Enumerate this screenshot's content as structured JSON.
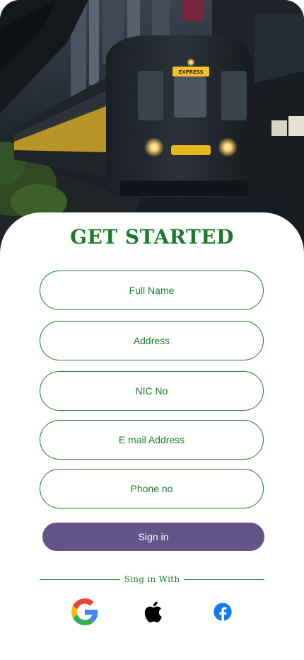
{
  "hero": {
    "train_sign_text": "EXPRESS"
  },
  "header": {
    "title": "GET STARTED"
  },
  "form": {
    "full_name_placeholder": "Full Name",
    "address_placeholder": "Address",
    "nic_placeholder": "NIC No",
    "email_placeholder": "E mail Address",
    "phone_placeholder": "Phone no"
  },
  "actions": {
    "sign_in_label": "Sign in"
  },
  "social": {
    "divider_label": "Sing in With",
    "providers": [
      "google-icon",
      "apple-icon",
      "facebook-icon"
    ]
  },
  "colors": {
    "accent_green": "#1f7a2e",
    "button_purple": "#63548a",
    "facebook_blue": "#1877f2"
  }
}
